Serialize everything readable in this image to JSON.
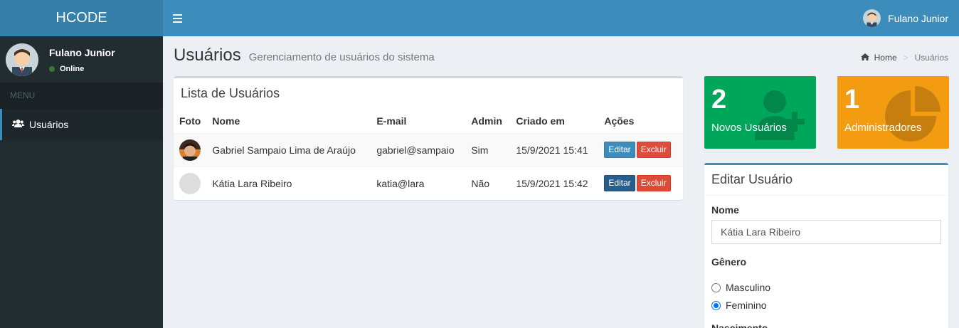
{
  "header": {
    "logo": "HCODE",
    "user_name": "Fulano Junior"
  },
  "sidebar": {
    "user_name": "Fulano Junior",
    "status": "Online",
    "menu_header": "MENU",
    "items": [
      {
        "label": "Usuários",
        "icon": "users-icon"
      }
    ]
  },
  "page": {
    "title": "Usuários",
    "subtitle": "Gerenciamento de usuários do sistema",
    "breadcrumb": {
      "home": "Home",
      "current": "Usuários"
    }
  },
  "users_list": {
    "title": "Lista de Usuários",
    "columns": [
      "Foto",
      "Nome",
      "E-mail",
      "Admin",
      "Criado em",
      "Ações"
    ],
    "rows": [
      {
        "name": "Gabriel Sampaio Lima de Araújo",
        "email": "gabriel@sampaio",
        "admin": "Sim",
        "created": "15/9/2021 15:41",
        "edit": "Editar",
        "delete": "Excluir"
      },
      {
        "name": "Kátia Lara Ribeiro",
        "email": "katia@lara",
        "admin": "Não",
        "created": "15/9/2021 15:42",
        "edit": "Editar",
        "delete": "Excluir"
      }
    ]
  },
  "stats": [
    {
      "value": "2",
      "label": "Novos Usuários",
      "color": "#00a65a",
      "icon": "user-plus-icon"
    },
    {
      "value": "1",
      "label": "Administradores",
      "color": "#f39c12",
      "icon": "pie-chart-icon"
    }
  ],
  "edit_user": {
    "title": "Editar Usuário",
    "name_label": "Nome",
    "name_value": "Kátia Lara Ribeiro",
    "gender_label": "Gênero",
    "gender_options": [
      "Masculino",
      "Feminino"
    ],
    "gender_selected": "Feminino",
    "birth_label": "Nascimento"
  }
}
